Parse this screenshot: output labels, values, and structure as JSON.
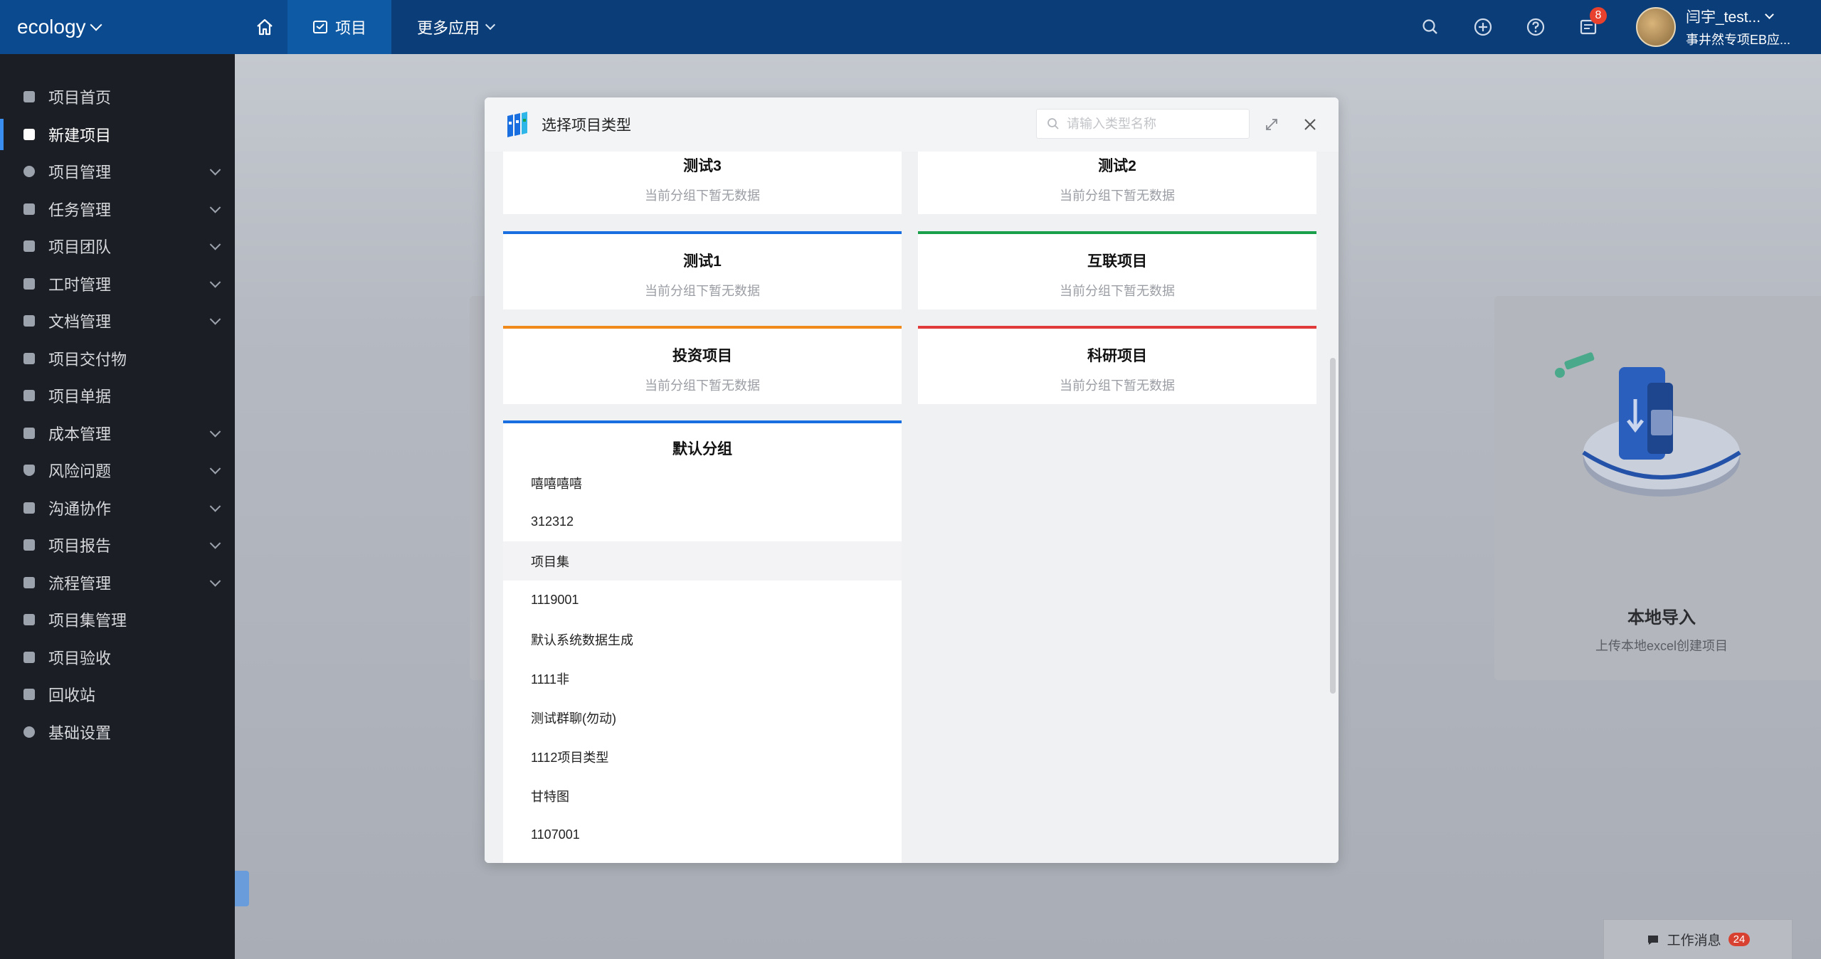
{
  "topbar": {
    "brand": "ecology",
    "nav_project": "项目",
    "nav_more": "更多应用",
    "notif_count": "8",
    "user_name": "闫宇_test...",
    "user_org": "事井然专项EB应..."
  },
  "sidebar": {
    "items": [
      {
        "label": "项目首页"
      },
      {
        "label": "新建项目"
      },
      {
        "label": "项目管理"
      },
      {
        "label": "任务管理"
      },
      {
        "label": "项目团队"
      },
      {
        "label": "工时管理"
      },
      {
        "label": "文档管理"
      },
      {
        "label": "项目交付物"
      },
      {
        "label": "项目单据"
      },
      {
        "label": "成本管理"
      },
      {
        "label": "风险问题"
      },
      {
        "label": "沟通协作"
      },
      {
        "label": "项目报告"
      },
      {
        "label": "流程管理"
      },
      {
        "label": "项目集管理"
      },
      {
        "label": "项目验收"
      },
      {
        "label": "回收站"
      },
      {
        "label": "基础设置"
      }
    ]
  },
  "background": {
    "import_title": "本地导入",
    "import_desc": "上传本地excel创建项目"
  },
  "msgbar": {
    "label": "工作消息",
    "count": "24"
  },
  "modal": {
    "title": "选择项目类型",
    "search_placeholder": "请输入类型名称",
    "empty_text": "当前分组下暂无数据",
    "groups": [
      {
        "title": "测试3"
      },
      {
        "title": "测试2"
      },
      {
        "title": "测试1"
      },
      {
        "title": "互联项目"
      },
      {
        "title": "投资项目"
      },
      {
        "title": "科研项目"
      }
    ],
    "default_group": {
      "title": "默认分组",
      "items": [
        "嘻嘻嘻嘻",
        "312312",
        "项目集",
        "1119001",
        "默认系统数据生成",
        "1111非",
        "测试群聊(勿动)",
        "1112项目类型",
        "甘特图",
        "1107001"
      ]
    }
  },
  "colors": {
    "topbar": "#0b3d78",
    "sidebar": "#1b1e25",
    "accent_blue": "#1a6fe0",
    "accent_green": "#1aa04a",
    "accent_orange": "#f08a1a",
    "accent_red": "#e03a3a"
  }
}
